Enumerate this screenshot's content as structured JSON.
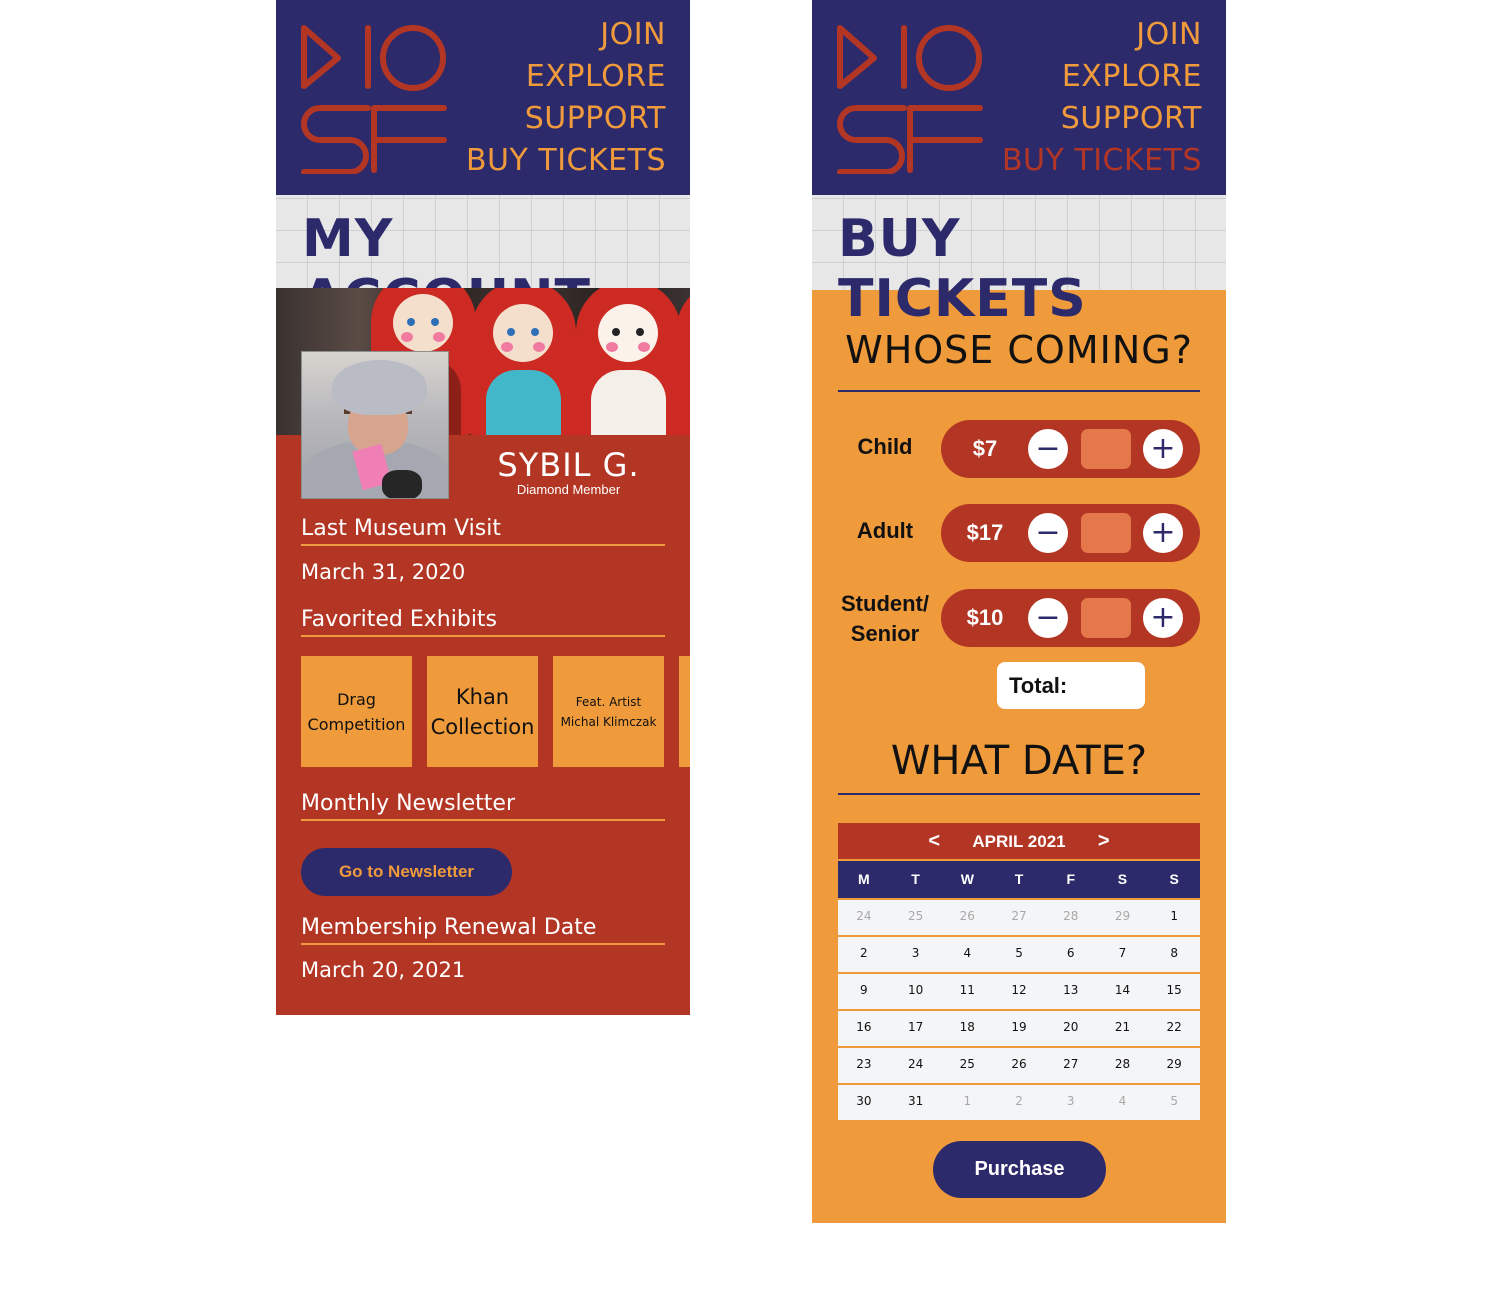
{
  "brand": {
    "logo_text": "MOSF",
    "colors": {
      "navy": "#2d2a6b",
      "rust": "#b33624",
      "orange": "#ef9a3b",
      "light": "#e6e7e6"
    }
  },
  "account_screen": {
    "nav": [
      {
        "label": "JOIN"
      },
      {
        "label": "EXPLORE"
      },
      {
        "label": "SUPPORT"
      },
      {
        "label": "BUY TICKETS"
      }
    ],
    "page_title": "MY ACCOUNT",
    "member": {
      "name": "SYBIL G.",
      "tier": "Diamond Member"
    },
    "last_visit": {
      "heading": "Last Museum Visit",
      "value": "March 31, 2020"
    },
    "favorites": {
      "heading": "Favorited Exhibits",
      "items": [
        {
          "line1": "Drag",
          "line2": "Competition"
        },
        {
          "line1": "Khan",
          "line2": "Collection"
        },
        {
          "line1": "Feat. Artist",
          "line2": "Michal Klimczak"
        },
        {
          "line1": "",
          "line2": ""
        }
      ]
    },
    "newsletter": {
      "heading": "Monthly Newsletter",
      "button_label": "Go to Newsletter"
    },
    "renewal": {
      "heading": "Membership Renewal Date",
      "value": "March 20, 2021"
    }
  },
  "tickets_screen": {
    "nav": [
      {
        "label": "JOIN"
      },
      {
        "label": "EXPLORE"
      },
      {
        "label": "SUPPORT"
      },
      {
        "label": "BUY TICKETS",
        "active": true
      }
    ],
    "page_title": "BUY TICKETS",
    "whose_heading": "WHOSE COMING?",
    "ticket_types": [
      {
        "label_line1": "Child",
        "label_line2": "",
        "price": "$7",
        "quantity": ""
      },
      {
        "label_line1": "Adult",
        "label_line2": "",
        "price": "$17",
        "quantity": ""
      },
      {
        "label_line1": "Student/",
        "label_line2": "Senior",
        "price": "$10",
        "quantity": ""
      }
    ],
    "minus_symbol": "−",
    "plus_symbol": "+",
    "total_label": "Total:",
    "date_heading": "WHAT DATE?",
    "calendar": {
      "prev": "<",
      "next": ">",
      "month": "APRIL 2021",
      "weekdays": [
        "M",
        "T",
        "W",
        "T",
        "F",
        "S",
        "S"
      ],
      "weeks": [
        [
          {
            "d": "24",
            "muted": true
          },
          {
            "d": "25",
            "muted": true
          },
          {
            "d": "26",
            "muted": true
          },
          {
            "d": "27",
            "muted": true
          },
          {
            "d": "28",
            "muted": true
          },
          {
            "d": "29",
            "muted": true
          },
          {
            "d": "1"
          }
        ],
        [
          {
            "d": "2"
          },
          {
            "d": "3"
          },
          {
            "d": "4"
          },
          {
            "d": "5"
          },
          {
            "d": "6"
          },
          {
            "d": "7"
          },
          {
            "d": "8"
          }
        ],
        [
          {
            "d": "9"
          },
          {
            "d": "10"
          },
          {
            "d": "11"
          },
          {
            "d": "12"
          },
          {
            "d": "13"
          },
          {
            "d": "14"
          },
          {
            "d": "15"
          }
        ],
        [
          {
            "d": "16"
          },
          {
            "d": "17"
          },
          {
            "d": "18"
          },
          {
            "d": "19"
          },
          {
            "d": "20"
          },
          {
            "d": "21"
          },
          {
            "d": "22"
          }
        ],
        [
          {
            "d": "23"
          },
          {
            "d": "24"
          },
          {
            "d": "25"
          },
          {
            "d": "26"
          },
          {
            "d": "27"
          },
          {
            "d": "28"
          },
          {
            "d": "29"
          }
        ],
        [
          {
            "d": "30"
          },
          {
            "d": "31"
          },
          {
            "d": "1",
            "muted": true
          },
          {
            "d": "2",
            "muted": true
          },
          {
            "d": "3",
            "muted": true
          },
          {
            "d": "4",
            "muted": true
          },
          {
            "d": "5",
            "muted": true
          }
        ]
      ]
    },
    "purchase_label": "Purchase"
  }
}
